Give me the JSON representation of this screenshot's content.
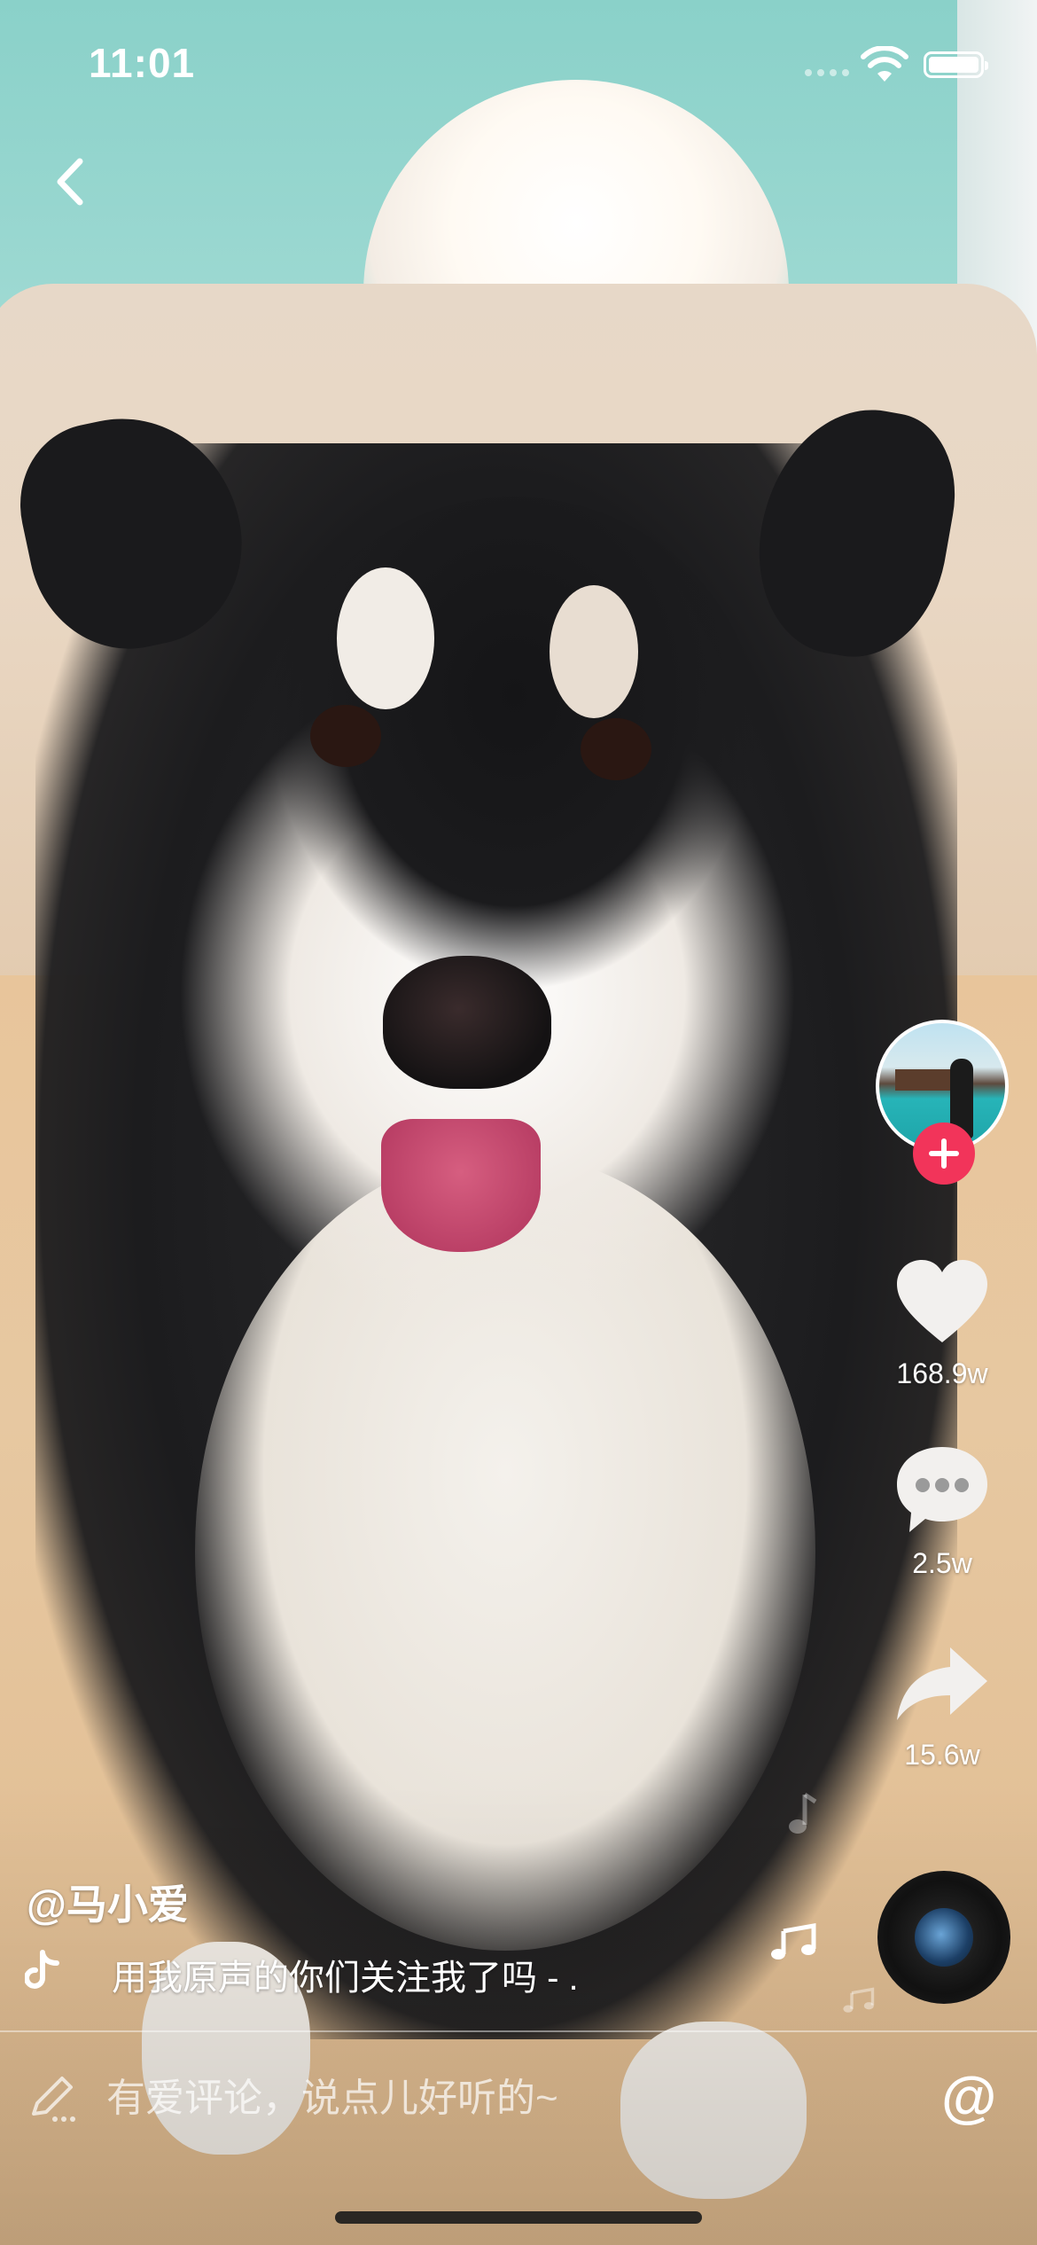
{
  "status_bar": {
    "time": "11:01",
    "battery_level": 1.0
  },
  "icons": {
    "back": "chevron-left-icon",
    "like": "heart-icon",
    "comment": "speech-bubble-icon",
    "share": "share-arrow-icon",
    "follow": "plus-icon",
    "music": "tiktok-note-icon",
    "edit": "pencil-icon"
  },
  "creator": {
    "follow_button_color": "#f2345a"
  },
  "actions": {
    "likes": "168.9w",
    "comments": "2.5w",
    "shares": "15.6w"
  },
  "caption": {
    "username": "@马小爱",
    "music_text": "用我原声的你们关注我了吗 - ."
  },
  "comment_bar": {
    "placeholder": "有爱评论，说点儿好听的~",
    "mention_label": "@"
  }
}
